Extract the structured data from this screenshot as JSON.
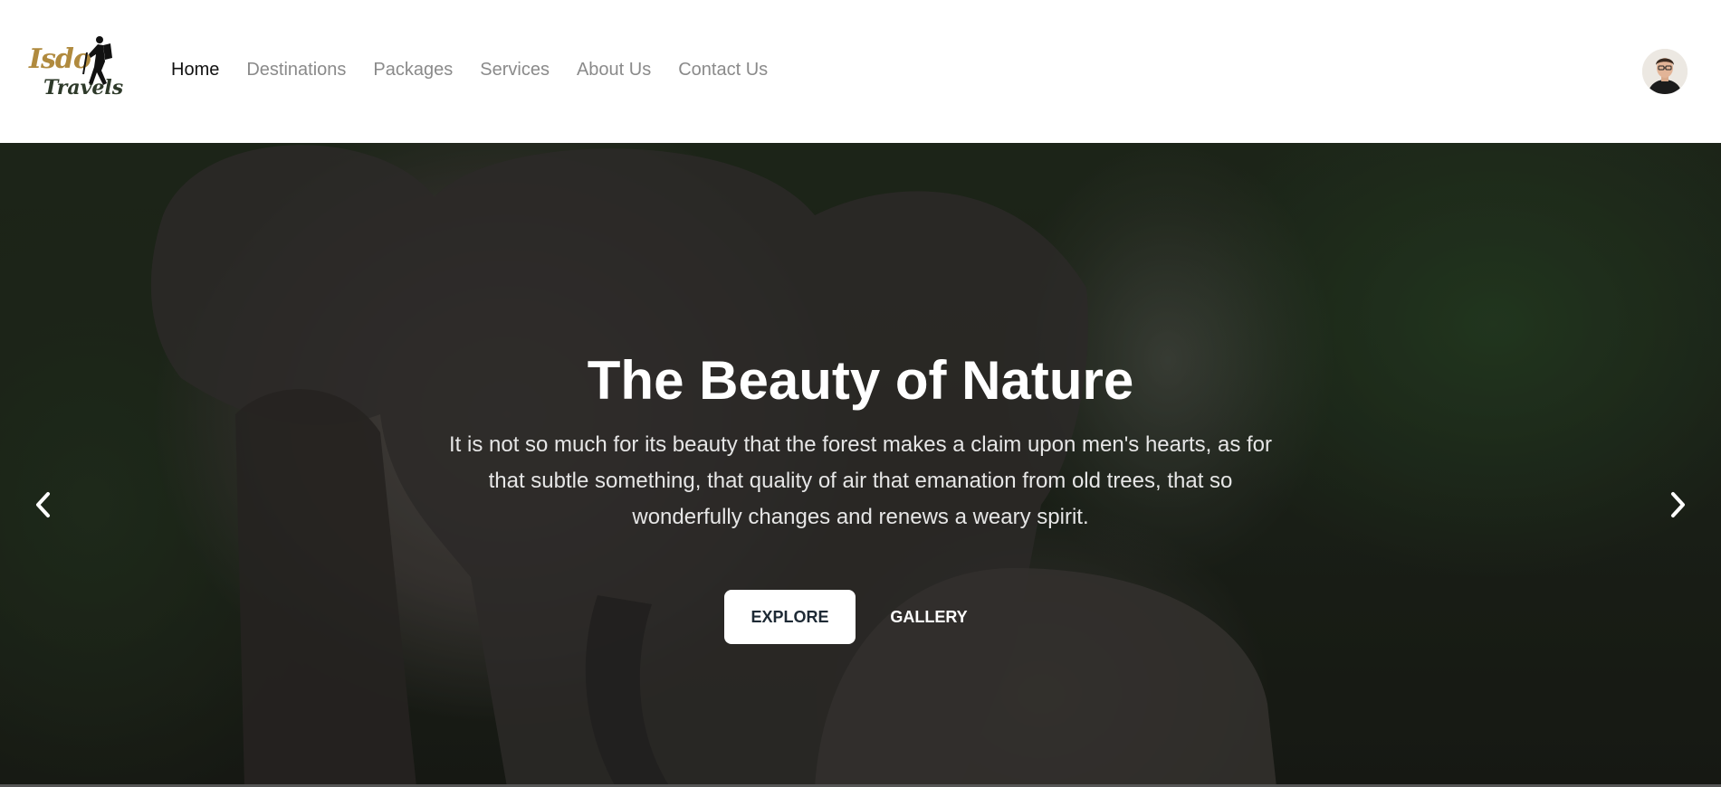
{
  "brand": {
    "logo_line1": "Isdo",
    "logo_line2": "Travels"
  },
  "nav": {
    "items": [
      {
        "label": "Home",
        "active": true
      },
      {
        "label": "Destinations",
        "active": false
      },
      {
        "label": "Packages",
        "active": false
      },
      {
        "label": "Services",
        "active": false
      },
      {
        "label": "About Us",
        "active": false
      },
      {
        "label": "Contact Us",
        "active": false
      }
    ]
  },
  "user": {
    "avatar_icon": "user-avatar"
  },
  "hero": {
    "title": "The Beauty of Nature",
    "text": "It is not so much for its beauty that the forest makes a claim upon men's hearts, as for that subtle something, that quality of air that emanation from old trees, that so wonderfully changes and renews a weary spirit.",
    "primary_button": "EXPLORE",
    "secondary_button": "GALLERY",
    "prev_icon": "chevron-left-icon",
    "next_icon": "chevron-right-icon"
  },
  "colors": {
    "nav_active": "#111111",
    "nav_inactive": "#8a8a8a",
    "logo_gold": "#b08a3e",
    "hero_text": "#ffffff"
  }
}
